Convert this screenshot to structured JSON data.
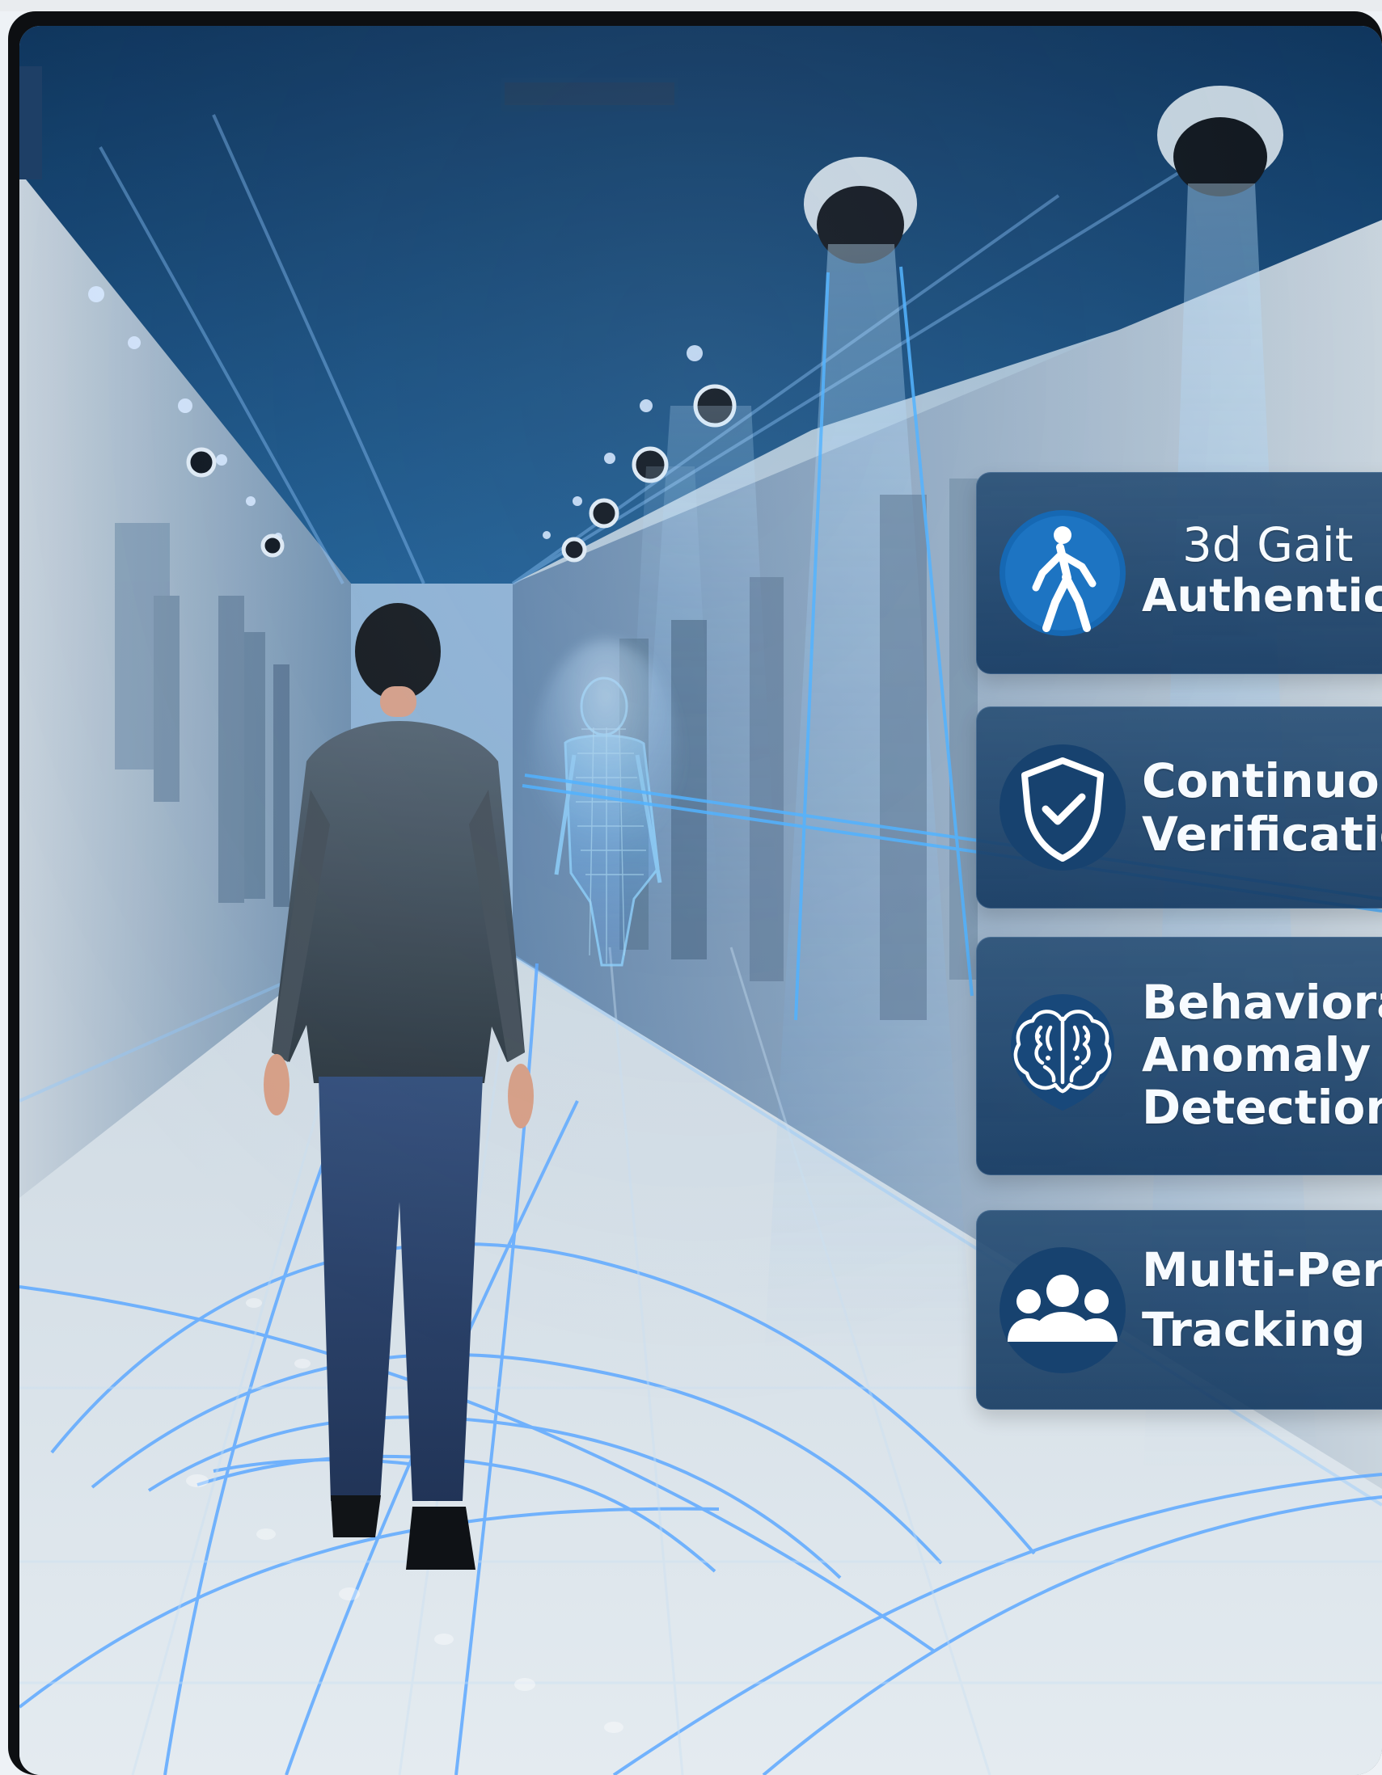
{
  "features": [
    {
      "label_lines": [
        "3d Gait",
        "Authentication"
      ],
      "icon": "walking-person-icon"
    },
    {
      "label_lines": [
        "Continuous",
        "Verification"
      ],
      "icon": "shield-check-icon"
    },
    {
      "label_lines": [
        "Behavioral",
        "Anomaly",
        "Detection"
      ],
      "icon": "brain-icon"
    },
    {
      "label_lines": [
        "Multi-Person",
        "Tracking"
      ],
      "icon": "people-group-icon"
    }
  ],
  "colors": {
    "panel_blue": "#163f6a",
    "icon_blue": "#1a69b2",
    "highlight_blue": "#3ea2ff",
    "text": "#ffffff"
  }
}
